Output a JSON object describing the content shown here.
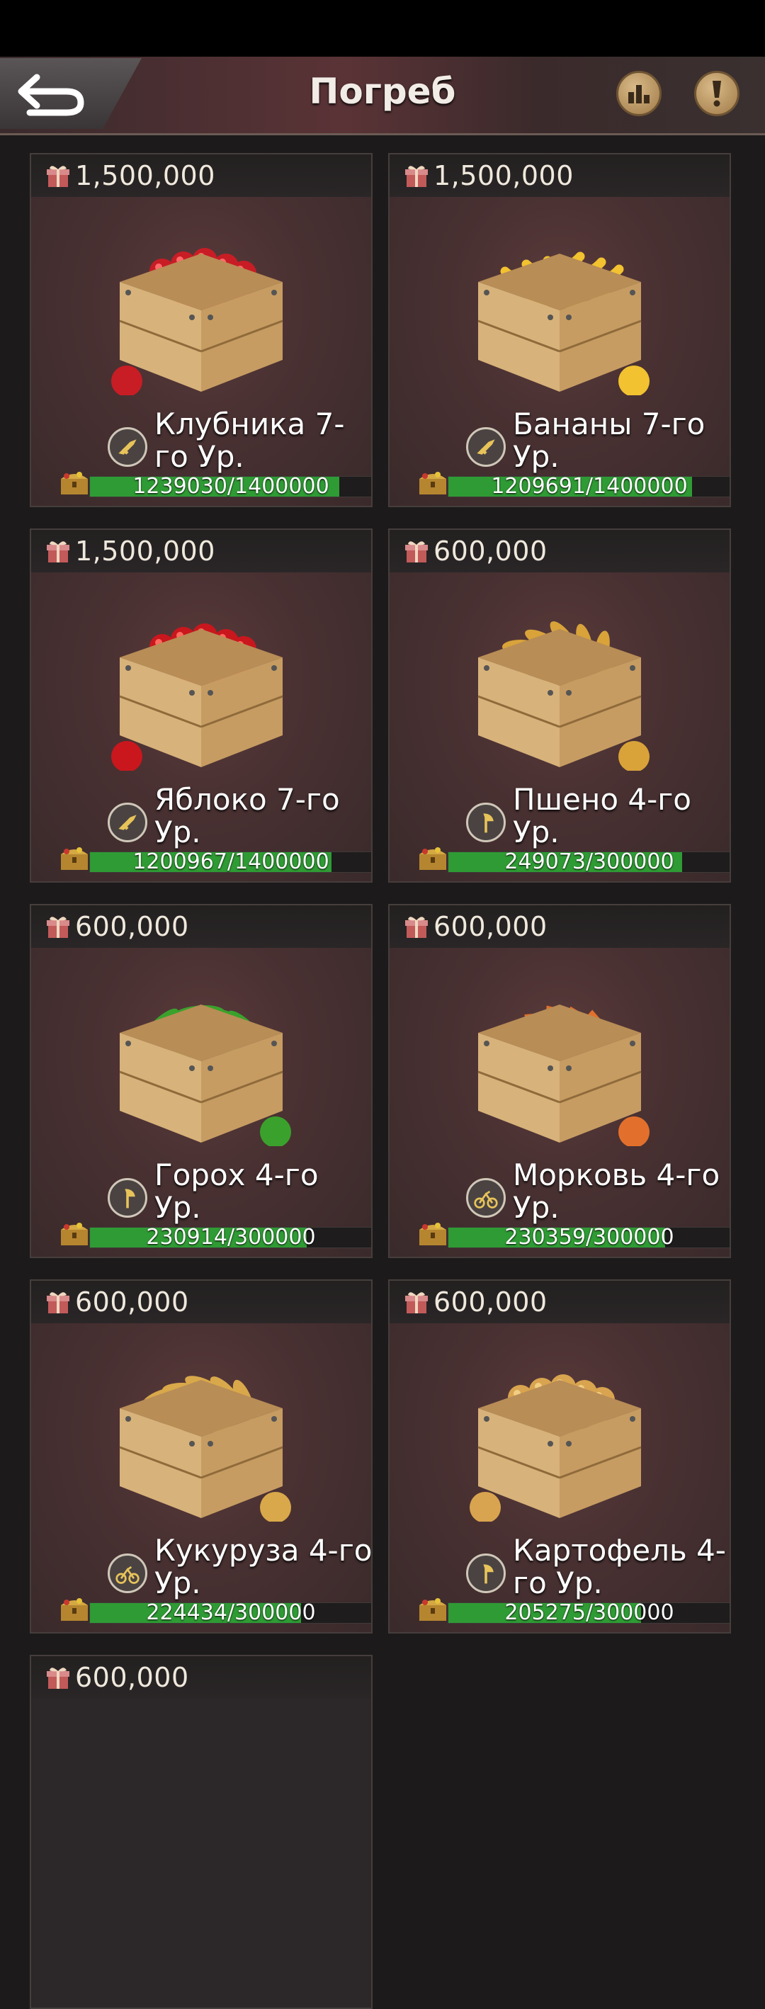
{
  "header": {
    "title": "Погреб"
  },
  "items": [
    {
      "cost": "1,500,000",
      "name": "Клубника 7-го Ур.",
      "progress_text": "1239030/1400000",
      "progress": 0.885,
      "item": "strawberry",
      "tool": "rifle-icon"
    },
    {
      "cost": "1,500,000",
      "name": "Бананы 7-го Ур.",
      "progress_text": "1209691/1400000",
      "progress": 0.864,
      "item": "banana",
      "tool": "rifle-icon"
    },
    {
      "cost": "1,500,000",
      "name": "Яблоко 7-го Ур.",
      "progress_text": "1200967/1400000",
      "progress": 0.858,
      "item": "apple",
      "tool": "rifle-icon"
    },
    {
      "cost": "600,000",
      "name": "Пшено 4-го Ур.",
      "progress_text": "249073/300000",
      "progress": 0.83,
      "item": "millet",
      "tool": "axe-icon"
    },
    {
      "cost": "600,000",
      "name": "Горох 4-го Ур.",
      "progress_text": "230914/300000",
      "progress": 0.77,
      "item": "peas",
      "tool": "axe-icon"
    },
    {
      "cost": "600,000",
      "name": "Морковь 4-го Ур.",
      "progress_text": "230359/300000",
      "progress": 0.768,
      "item": "carrot",
      "tool": "bike-icon"
    },
    {
      "cost": "600,000",
      "name": "Кукуруза 4-го Ур.",
      "progress_text": "224434/300000",
      "progress": 0.748,
      "item": "corn",
      "tool": "bike-icon"
    },
    {
      "cost": "600,000",
      "name": "Картофель 4-го Ур.",
      "progress_text": "205275/300000",
      "progress": 0.684,
      "item": "potato",
      "tool": "axe-icon"
    },
    {
      "cost": "600,000"
    }
  ]
}
